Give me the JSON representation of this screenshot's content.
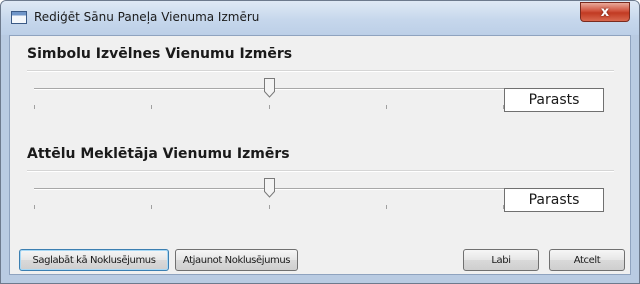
{
  "window": {
    "title": "Rediģēt Sānu Paneļa Vienuma Izmēru",
    "close_label": "x"
  },
  "symbols_group": {
    "label": "Simbolu Izvēlnes Vienumu Izmērs",
    "slider_position": 0.5,
    "value": "Parasts"
  },
  "images_group": {
    "label": "Attēlu Meklētāja Vienumu Izmērs",
    "slider_position": 0.5,
    "value": "Parasts"
  },
  "buttons": {
    "save_default": "Saglabāt kā Noklusējumus",
    "restore_default": "Atjaunot Noklusējumus",
    "ok": "Labi",
    "cancel": "Atcelt"
  }
}
